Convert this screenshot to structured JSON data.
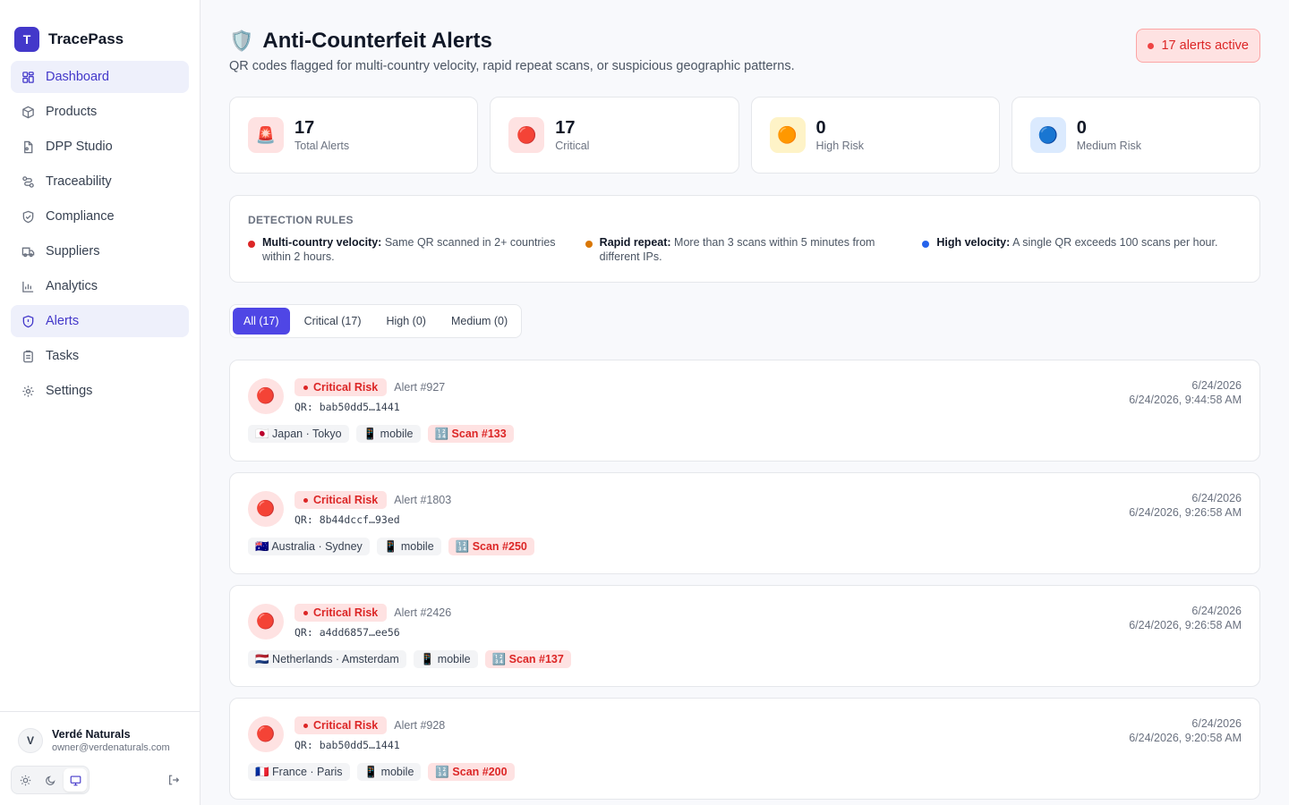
{
  "brand": {
    "logo_letter": "T",
    "name": "TracePass"
  },
  "nav": [
    {
      "label": "Dashboard",
      "icon": "grid-icon",
      "active": true
    },
    {
      "label": "Products",
      "icon": "box-icon",
      "active": false
    },
    {
      "label": "DPP Studio",
      "icon": "file-icon",
      "active": false
    },
    {
      "label": "Traceability",
      "icon": "route-icon",
      "active": false
    },
    {
      "label": "Compliance",
      "icon": "shield-check-icon",
      "active": false
    },
    {
      "label": "Suppliers",
      "icon": "truck-icon",
      "active": false
    },
    {
      "label": "Analytics",
      "icon": "chart-icon",
      "active": false
    },
    {
      "label": "Alerts",
      "icon": "shield-alert-icon",
      "active": true
    },
    {
      "label": "Tasks",
      "icon": "clipboard-icon",
      "active": false
    },
    {
      "label": "Settings",
      "icon": "gear-icon",
      "active": false
    }
  ],
  "user": {
    "initial": "V",
    "name": "Verdé Naturals",
    "email": "owner@verdenaturals.com"
  },
  "header": {
    "icon": "🛡️",
    "title": "Anti-Counterfeit Alerts",
    "subtitle": "QR codes flagged for multi-country velocity, rapid repeat scans, or suspicious geographic patterns.",
    "active_label": "17 alerts active"
  },
  "stats": [
    {
      "icon": "🚨",
      "value": "17",
      "label": "Total Alerts",
      "bg": "#fee2e2"
    },
    {
      "icon": "🔴",
      "value": "17",
      "label": "Critical",
      "bg": "#fee2e2"
    },
    {
      "icon": "🟠",
      "value": "0",
      "label": "High Risk",
      "bg": "#fef3c7"
    },
    {
      "icon": "🔵",
      "value": "0",
      "label": "Medium Risk",
      "bg": "#dbeafe"
    }
  ],
  "rules": {
    "heading": "DETECTION RULES",
    "items": [
      {
        "title": "Multi-country velocity:",
        "text": "Same QR scanned in 2+ countries within 2 hours.",
        "color": "#dc2626"
      },
      {
        "title": "Rapid repeat:",
        "text": "More than 3 scans within 5 minutes from different IPs.",
        "color": "#d97706"
      },
      {
        "title": "High velocity:",
        "text": "A single QR exceeds 100 scans per hour.",
        "color": "#2563eb"
      }
    ]
  },
  "tabs": [
    {
      "label": "All (17)",
      "active": true
    },
    {
      "label": "Critical (17)",
      "active": false
    },
    {
      "label": "High (0)",
      "active": false
    },
    {
      "label": "Medium (0)",
      "active": false
    }
  ],
  "alerts": [
    {
      "icon": "🔴",
      "risk": "Critical Risk",
      "id": "Alert #927",
      "qr": "QR: bab50dd5…1441",
      "location": "🇯🇵 Japan · Tokyo",
      "device": "📱 mobile",
      "scan": "🔢 Scan #133",
      "date": "6/24/2026",
      "datetime": "6/24/2026, 9:44:58 AM"
    },
    {
      "icon": "🔴",
      "risk": "Critical Risk",
      "id": "Alert #1803",
      "qr": "QR: 8b44dccf…93ed",
      "location": "🇦🇺 Australia · Sydney",
      "device": "📱 mobile",
      "scan": "🔢 Scan #250",
      "date": "6/24/2026",
      "datetime": "6/24/2026, 9:26:58 AM"
    },
    {
      "icon": "🔴",
      "risk": "Critical Risk",
      "id": "Alert #2426",
      "qr": "QR: a4dd6857…ee56",
      "location": "🇳🇱 Netherlands · Amsterdam",
      "device": "📱 mobile",
      "scan": "🔢 Scan #137",
      "date": "6/24/2026",
      "datetime": "6/24/2026, 9:26:58 AM"
    },
    {
      "icon": "🔴",
      "risk": "Critical Risk",
      "id": "Alert #928",
      "qr": "QR: bab50dd5…1441",
      "location": "🇫🇷 France · Paris",
      "device": "📱 mobile",
      "scan": "🔢 Scan #200",
      "date": "6/24/2026",
      "datetime": "6/24/2026, 9:20:58 AM"
    }
  ]
}
